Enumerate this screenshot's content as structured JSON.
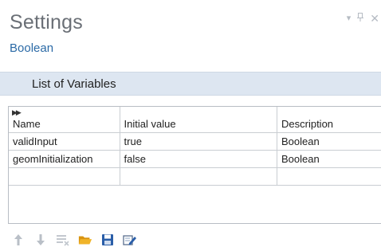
{
  "window": {
    "title": "Settings",
    "subtitle": "Boolean",
    "controls": [
      "pin-dropdown-icon",
      "pin-icon",
      "close-icon"
    ]
  },
  "section": {
    "title": "List of Variables"
  },
  "table": {
    "columns": [
      "Name",
      "Initial value",
      "Description"
    ],
    "rows": [
      [
        "validInput",
        "true",
        "Boolean"
      ],
      [
        "geomInitialization",
        "false",
        "Boolean"
      ],
      [
        "",
        "",
        ""
      ]
    ]
  },
  "toolbar": {
    "icons": [
      "move-up-icon",
      "move-down-icon",
      "clear-table-icon",
      "load-from-file-icon",
      "save-to-file-icon",
      "edit-icon"
    ]
  },
  "colors": {
    "title": "#6a6f76",
    "subtitle": "#2b6aa6",
    "section_bg": "#dde6f1",
    "folder": "#e8a317",
    "save": "#2a5ea8"
  }
}
